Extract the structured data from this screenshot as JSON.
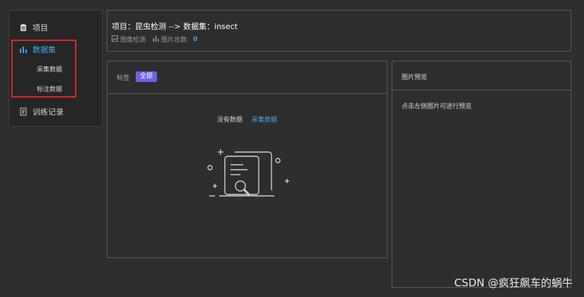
{
  "sidebar": {
    "items": [
      {
        "label": "项目",
        "icon": "clipboard-icon"
      },
      {
        "label": "数据集",
        "icon": "bar-chart-icon",
        "active": true
      },
      {
        "label": "训练记录",
        "icon": "document-icon"
      }
    ],
    "sub_items": [
      {
        "label": "采集数据"
      },
      {
        "label": "标注数据"
      }
    ]
  },
  "header": {
    "title": "项目：昆虫检测 --> 数据集：insect",
    "type_label": "图像检测",
    "total_label": "图片总数:",
    "total_count": "0"
  },
  "main": {
    "tag_label": "标签",
    "tag_all": "全部",
    "empty_text": "没有数据",
    "collect_link": "采集数据"
  },
  "preview": {
    "title": "图片预览",
    "hint": "点击左侧图片可进行预览"
  },
  "watermark": "CSDN @疯狂飙车的蜗牛",
  "colors": {
    "accent_blue": "#4aa3e8",
    "tag_purple": "#6d63e6",
    "highlight_red": "#e0242b"
  }
}
